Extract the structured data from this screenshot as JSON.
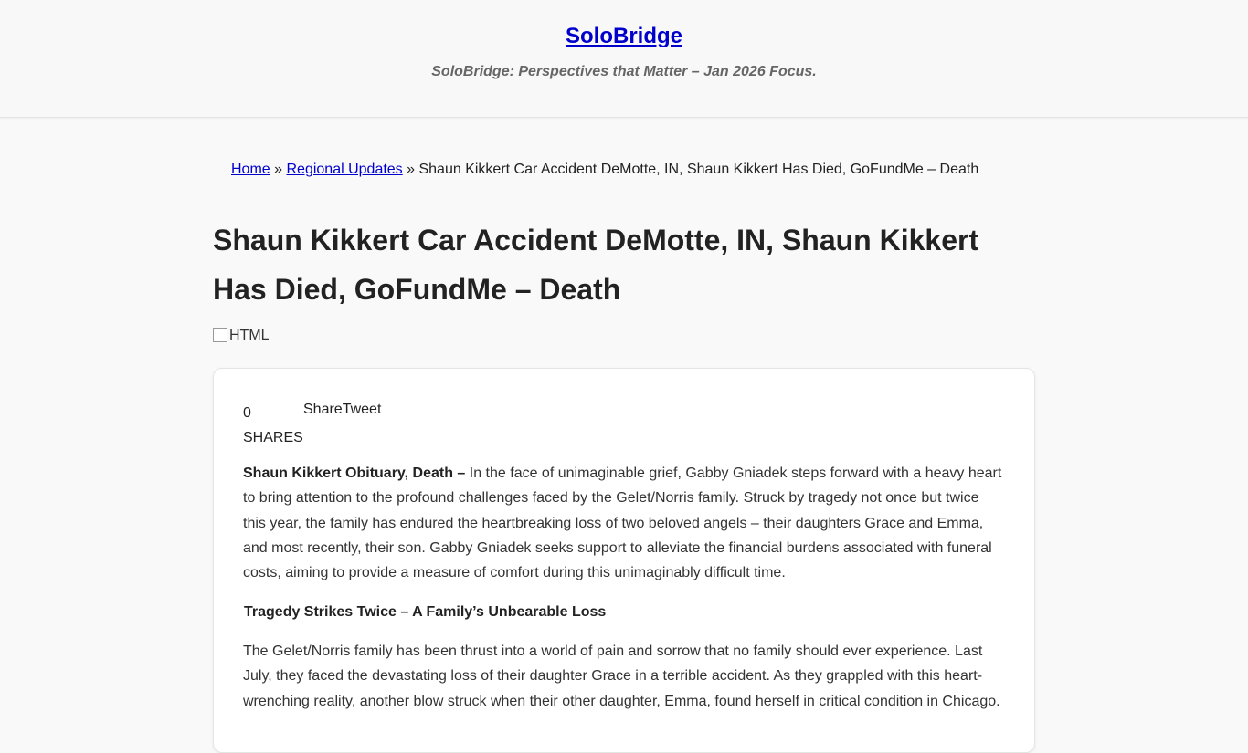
{
  "header": {
    "site_title": "SoloBridge",
    "tagline": "SoloBridge: Perspectives that Matter – Jan 2026 Focus."
  },
  "breadcrumb": {
    "home": "Home",
    "sep1": " » ",
    "category": "Regional Updates",
    "sep2": " » ",
    "current": "Shaun Kikkert Car Accident DeMotte, IN, Shaun Kikkert Has Died, GoFundMe – Death"
  },
  "post": {
    "title": "Shaun Kikkert Car Accident DeMotte, IN, Shaun Kikkert Has Died, GoFundMe – Death",
    "image_alt": "HTML",
    "share_count": "0",
    "shares_label": "SHARES",
    "share_label": "Share",
    "tweet_label": "Tweet",
    "intro_lead": "Shaun Kikkert Obituary, Death – ",
    "intro_text": "In the face of unimaginable grief, Gabby Gniadek steps forward with a heavy heart to bring attention to the profound challenges faced by the Gelet/Norris family. Struck by tragedy not once but twice this year, the family has endured the heartbreaking loss of two beloved angels – their daughters Grace and Emma, and most recently, their son. Gabby Gniadek seeks support to alleviate the financial burdens associated with funeral costs, aiming to provide a measure of comfort during this unimaginably difficult time.",
    "subheading": "Tragedy Strikes Twice – A Family’s Unbearable Loss",
    "para2": "The Gelet/Norris family has been thrust into a world of pain and sorrow that no family should ever experience. Last July, they faced the devastating loss of their daughter Grace in a terrible accident. As they grappled with this heart-wrenching reality, another blow struck when their other daughter, Emma, found herself in critical condition in Chicago."
  },
  "colors": {
    "link": "#0000cc",
    "header_bg": "#f8f8f8",
    "page_bg": "#f9f9f9"
  }
}
